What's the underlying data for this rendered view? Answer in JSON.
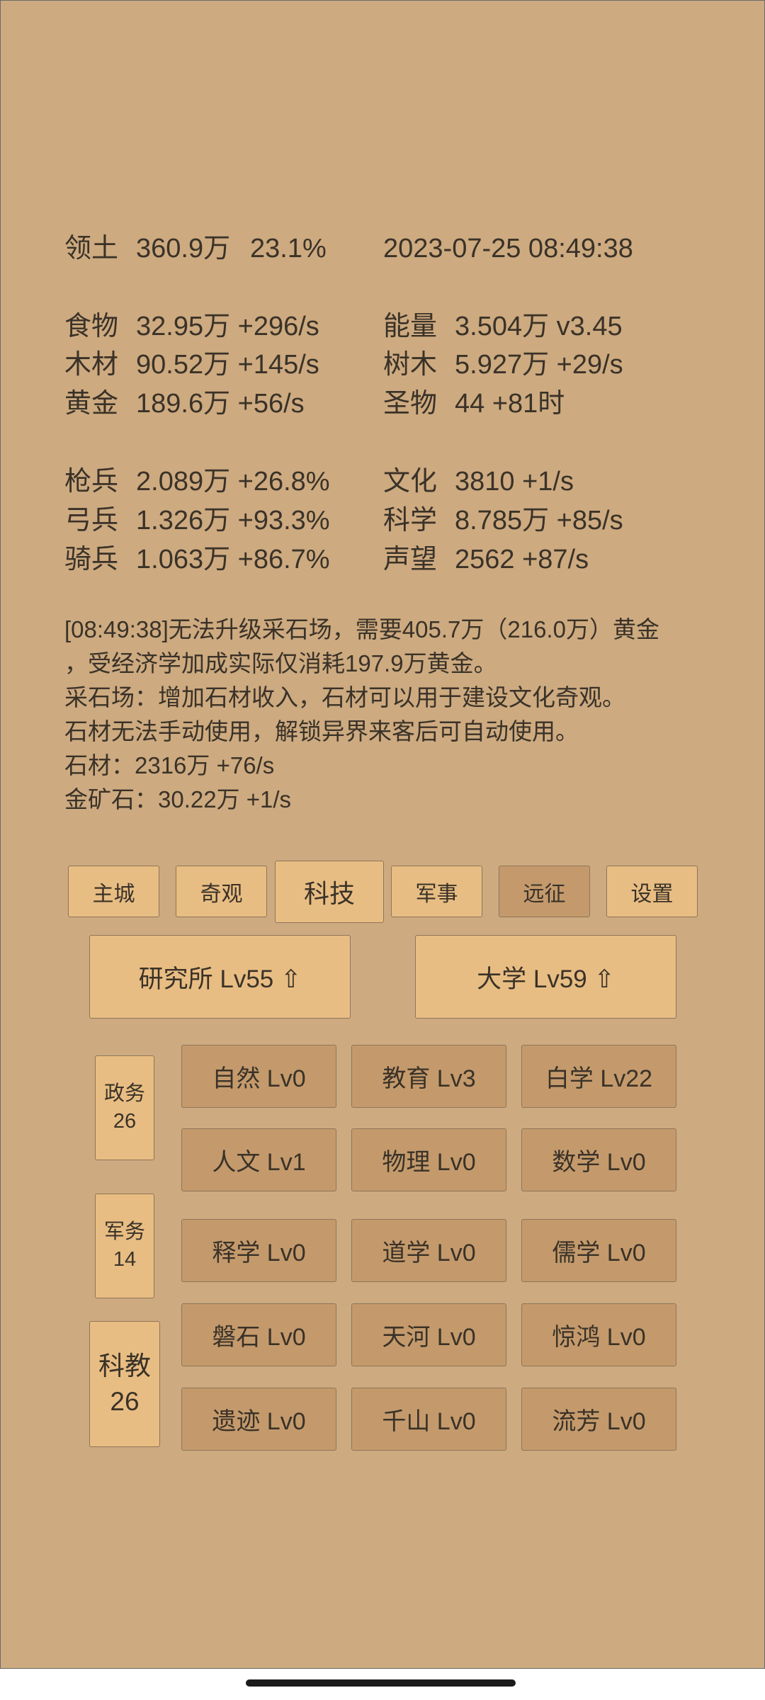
{
  "stats": {
    "territory": {
      "label": "领土",
      "value": "360.9万",
      "percent": "23.1%"
    },
    "datetime": "2023-07-25 08:49:38",
    "rows1": [
      {
        "left_label": "食物",
        "left_value": "32.95万 +296/s",
        "right_label": "能量",
        "right_value": "3.504万  v3.45"
      },
      {
        "left_label": "木材",
        "left_value": "90.52万 +145/s",
        "right_label": "树木",
        "right_value": "5.927万 +29/s"
      },
      {
        "left_label": "黄金",
        "left_value": "189.6万 +56/s",
        "right_label": "圣物",
        "right_value": "44 +81时"
      }
    ],
    "rows2": [
      {
        "left_label": "枪兵",
        "left_value": "2.089万 +26.8%",
        "right_label": "文化",
        "right_value": "3810 +1/s"
      },
      {
        "left_label": "弓兵",
        "left_value": "1.326万 +93.3%",
        "right_label": "科学",
        "right_value": "8.785万 +85/s"
      },
      {
        "left_label": "骑兵",
        "left_value": "1.063万 +86.7%",
        "right_label": "声望",
        "right_value": "2562 +87/s"
      }
    ]
  },
  "log": [
    "[08:49:38]无法升级采石场，需要405.7万（216.0万）黄金",
    "，受经济学加成实际仅消耗197.9万黄金。",
    "采石场：增加石材收入，石材可以用于建设文化奇观。",
    "石材无法手动使用，解锁异界来客后可自动使用。",
    "石材：2316万 +76/s",
    "金矿石：30.22万 +1/s"
  ],
  "tabs": [
    "主城",
    "奇观",
    "科技",
    "军事",
    "远征",
    "设置"
  ],
  "buildings": [
    "研究所 Lv55 ⇧",
    "大学 Lv59 ⇧"
  ],
  "side": [
    {
      "name": "政务",
      "count": "26"
    },
    {
      "name": "军务",
      "count": "14"
    },
    {
      "name": "科教",
      "count": "26"
    }
  ],
  "tech": [
    "自然 Lv0",
    "教育 Lv3",
    "白学 Lv22",
    "人文 Lv1",
    "物理 Lv0",
    "数学 Lv0",
    "释学 Lv0",
    "道学 Lv0",
    "儒学 Lv0",
    "磐石 Lv0",
    "天河 Lv0",
    "惊鸿 Lv0",
    "遗迹 Lv0",
    "千山 Lv0",
    "流芳 Lv0"
  ],
  "colors": {
    "background": "#cdaa80",
    "button_light": "#e8bd83",
    "button_dark": "#c49a6c",
    "text": "#3a3228"
  }
}
